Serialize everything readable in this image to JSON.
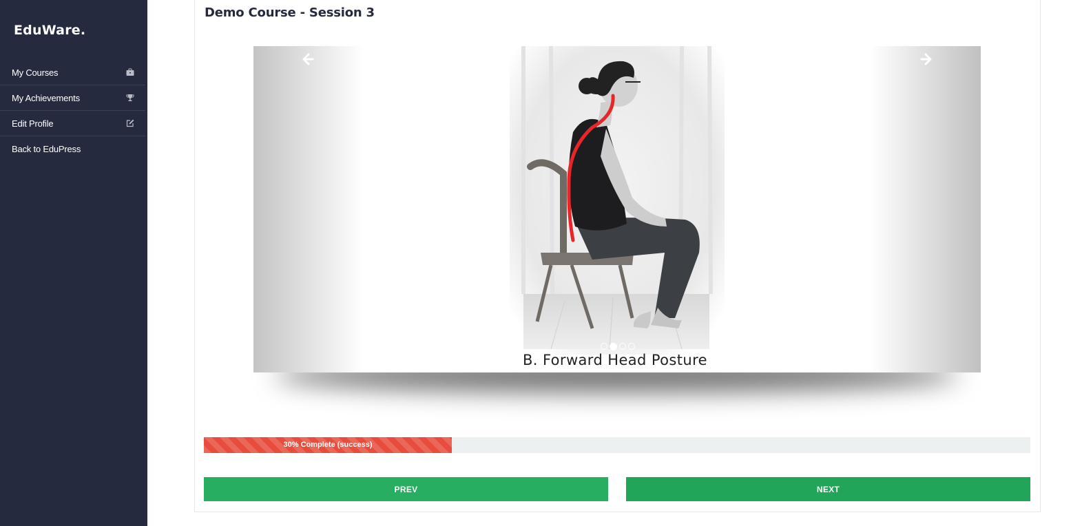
{
  "sidebar": {
    "brand": "EduWare.",
    "items": [
      {
        "label": "My Courses",
        "icon": "briefcase-icon"
      },
      {
        "label": "My Achievements",
        "icon": "trophy-icon"
      },
      {
        "label": "Edit Profile",
        "icon": "edit-icon"
      },
      {
        "label": "Back to EduPress",
        "icon": ""
      }
    ]
  },
  "main": {
    "title": "Demo Course - Session 3",
    "slider": {
      "caption": "B. Forward Head Posture",
      "slide_count": 4,
      "active_slide": 2,
      "prev_icon": "arrow-left-icon",
      "next_icon": "arrow-right-icon"
    },
    "progress": {
      "percent": 30,
      "label": "30% Complete (success)",
      "color": "#e74c3c"
    },
    "buttons": {
      "prev": "PREV",
      "next": "NEXT"
    }
  },
  "colors": {
    "sidebar_bg": "#262a3f",
    "accent_green": "#27ae60",
    "progress_track": "#ecf0f1"
  }
}
